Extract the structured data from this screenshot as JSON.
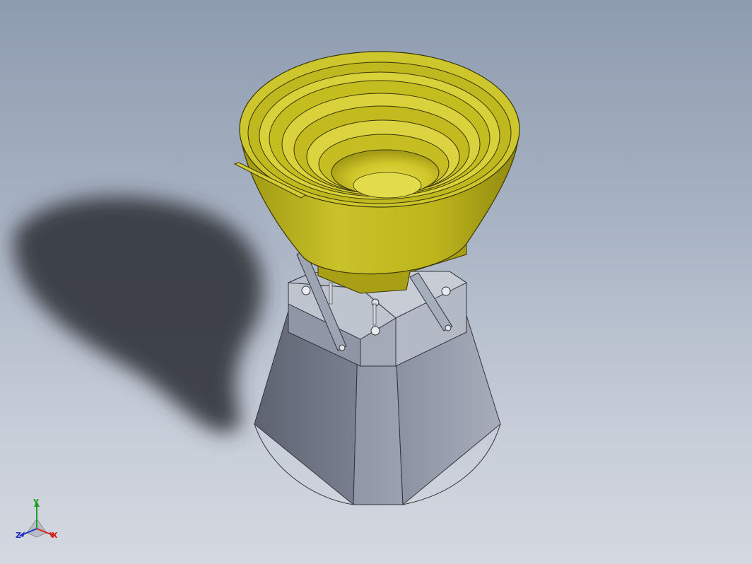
{
  "triad": {
    "x_label": "X",
    "y_label": "Y",
    "z_label": "Z"
  },
  "colors": {
    "background_top": "#8e9cb0",
    "background_bottom": "#d4d8e0",
    "bowl": "#c8c21a",
    "base": "#8c94a6",
    "x_axis": "#d02020",
    "y_axis": "#20a020",
    "z_axis": "#2030c0"
  }
}
